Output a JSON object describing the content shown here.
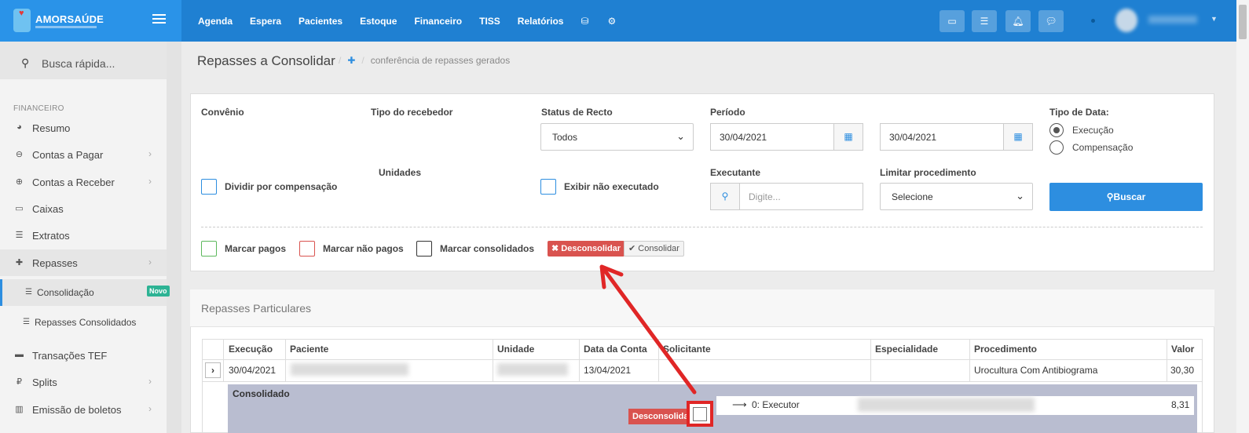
{
  "brand": {
    "name": "AMORSAÚDE"
  },
  "nav": {
    "items": [
      "Agenda",
      "Espera",
      "Pacientes",
      "Estoque",
      "Financeiro",
      "TISS",
      "Relatórios"
    ],
    "icons": [
      "database-icon",
      "gear-icon"
    ]
  },
  "topbar": {
    "icons": [
      "inbox-icon",
      "card-icon",
      "bell-icon",
      "chat-icon"
    ]
  },
  "sidebar": {
    "search_label": "Busca rápida...",
    "section": "FINANCEIRO",
    "items": [
      {
        "label": "Resumo",
        "icon": "pie-icon",
        "chevron": false
      },
      {
        "label": "Contas a Pagar",
        "icon": "minus-circle-icon",
        "chevron": true
      },
      {
        "label": "Contas a Receber",
        "icon": "plus-circle-icon",
        "chevron": true
      },
      {
        "label": "Caixas",
        "icon": "inbox-icon",
        "chevron": false
      },
      {
        "label": "Extratos",
        "icon": "list-icon",
        "chevron": false
      },
      {
        "label": "Repasses",
        "icon": "puzzle-icon",
        "chevron": true
      }
    ],
    "subitems": [
      {
        "label": "Consolidação",
        "badge": "Novo"
      },
      {
        "label": "Repasses Consolidados"
      }
    ],
    "items2": [
      {
        "label": "Transações TEF",
        "icon": "credit-card-icon",
        "chevron": false
      },
      {
        "label": "Splits",
        "icon": "ruble-icon",
        "chevron": true
      },
      {
        "label": "Emissão de boletos",
        "icon": "barcode-icon",
        "chevron": true
      }
    ]
  },
  "page": {
    "title": "Repasses a Consolidar",
    "breadcrumb": "conferência de repasses gerados"
  },
  "filters": {
    "convenio_label": "Convênio",
    "tipo_recebedor_label": "Tipo do recebedor",
    "status_label": "Status de Recto",
    "status_value": "Todos",
    "periodo_label": "Período",
    "date_from": "30/04/2021",
    "date_to": "30/04/2021",
    "tipo_data_label": "Tipo de Data:",
    "tipo_data_options": [
      "Execução",
      "Compensação"
    ],
    "tipo_data_selected": "Execução",
    "dividir_label": "Dividir por compensação",
    "unidades_label": "Unidades",
    "exibir_label": "Exibir não executado",
    "executante_label": "Executante",
    "executante_placeholder": "Digite...",
    "limitar_label": "Limitar procedimento",
    "limitar_value": "Selecione",
    "buscar_label": "Buscar",
    "marcar_pagos": "Marcar pagos",
    "marcar_nao_pagos": "Marcar não pagos",
    "marcar_consolidados": "Marcar consolidados",
    "desconsolidar": "Desconsolidar",
    "consolidar": "Consolidar"
  },
  "particulares": {
    "title": "Repasses Particulares",
    "columns": [
      "Execução",
      "Paciente",
      "Unidade",
      "Data da Conta",
      "Solicitante",
      "Especialidade",
      "Procedimento",
      "Valor"
    ],
    "row": {
      "execucao": "30/04/2021",
      "data_conta": "13/04/2021",
      "procedimento": "Urocultura Com Antibiograma",
      "valor": "30,30"
    },
    "consolidado_label": "Consolidado",
    "desconsolidar_label": "Desconsolidar",
    "executor_label": "0: Executor",
    "executor_valor": "8,31"
  },
  "annotation_color": "#e02626"
}
